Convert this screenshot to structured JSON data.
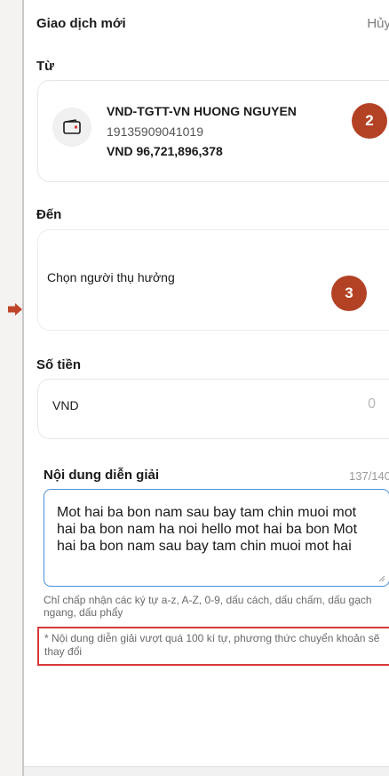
{
  "header": {
    "title": "Giao dịch mới",
    "cancel_label": "Hủy"
  },
  "from": {
    "label": "Từ",
    "account_name": "VND-TGTT-VN HUONG NGUYEN",
    "account_number": "19135909041019",
    "balance": "VND 96,721,896,378",
    "icon": "wallet-icon"
  },
  "to": {
    "label": "Đến",
    "placeholder": "Chọn người thụ hưởng"
  },
  "amount": {
    "label": "Số tiền",
    "currency": "VND",
    "value": "0"
  },
  "description": {
    "label": "Nội dung diễn giải",
    "counter": "137/140",
    "value": "Mot hai ba bon nam sau bay tam chin muoi mot hai ba bon nam ha noi hello mot hai ba bon Mot hai ba bon nam sau bay tam chin muoi mot hai",
    "hint": "Chỉ chấp nhận các ký tự a-z, A-Z, 0-9, dấu cách, dấu chấm, dấu gạch ngang, dấu phẩy",
    "warning": "* Nội dung diễn giải vượt quá 100 kí tự, phương thức chuyển khoản sẽ thay đổi"
  },
  "annotations": {
    "badge_2": "2",
    "badge_3": "3"
  },
  "colors": {
    "badge": "#b34224",
    "warning_border": "#d63a3a",
    "focus_border": "#4b8fd6"
  }
}
